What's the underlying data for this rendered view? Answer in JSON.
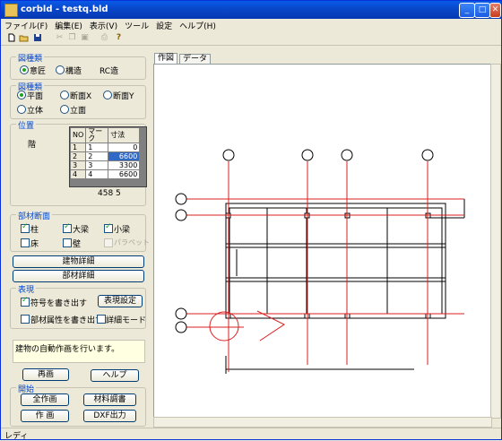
{
  "window": {
    "title": "corbld - testq.bld",
    "minimize": "_",
    "maximize": "□",
    "close": "✕"
  },
  "menu": [
    "ファイル(F)",
    "編集(E)",
    "表示(V)",
    "ツール",
    "設定",
    "ヘルプ(H)"
  ],
  "toolbar": {
    "icons": [
      "new-file-icon",
      "open-folder-icon",
      "save-icon",
      "cut-icon",
      "copy-icon",
      "paste-icon",
      "print-icon",
      "help-icon"
    ],
    "help_glyph": "?"
  },
  "drawing_type": {
    "title": "図種類",
    "options": [
      "意匠",
      "構造"
    ],
    "selected": "意匠",
    "extra": "RC造"
  },
  "view_type": {
    "title": "図種類",
    "options": [
      "平面",
      "断面X",
      "断面Y",
      "立体",
      "立面"
    ],
    "selected": "平面"
  },
  "position": {
    "title": "位置",
    "floor_label": "階",
    "columns": [
      "NO",
      "マーク",
      "寸法"
    ],
    "rows": [
      [
        "1",
        "1",
        "0"
      ],
      [
        "2",
        "2",
        "6600"
      ],
      [
        "3",
        "3",
        "3300"
      ],
      [
        "4",
        "4",
        "6600"
      ]
    ],
    "selected_row": 1,
    "footer": "458   5"
  },
  "members": {
    "title": "部材断面",
    "items": [
      {
        "label": "柱",
        "checked": true,
        "enabled": true
      },
      {
        "label": "大梁",
        "checked": true,
        "enabled": true
      },
      {
        "label": "小梁",
        "checked": true,
        "enabled": true
      },
      {
        "label": "床",
        "checked": false,
        "enabled": true
      },
      {
        "label": "壁",
        "checked": false,
        "enabled": true
      },
      {
        "label": "パラペット",
        "checked": false,
        "enabled": false
      }
    ],
    "building_detail": "建物詳細",
    "member_detail": "部材詳細"
  },
  "display": {
    "title": "表現",
    "write_symbols": "符号を書き出す",
    "write_symbols_checked": true,
    "display_settings": "表現設定",
    "write_attributes": "部材属性を書き出す",
    "write_attributes_checked": false,
    "detail_mode": "詳細モード",
    "detail_mode_checked": false
  },
  "message": "建物の自動作画を行います。",
  "actions": {
    "redraw": "再画",
    "help": "ヘルプ",
    "start_title": "開始",
    "draw_all": "全作画",
    "material_survey": "材料調書",
    "draw": "作 画",
    "dxf_output": "DXF出力"
  },
  "tabs": [
    "作図",
    "データ"
  ],
  "active_tab": "作図",
  "status": "レディ",
  "colors": {
    "grid_red": "#dd1f1f",
    "plan_black": "#000000",
    "title_blue": "#0a5ae8"
  }
}
